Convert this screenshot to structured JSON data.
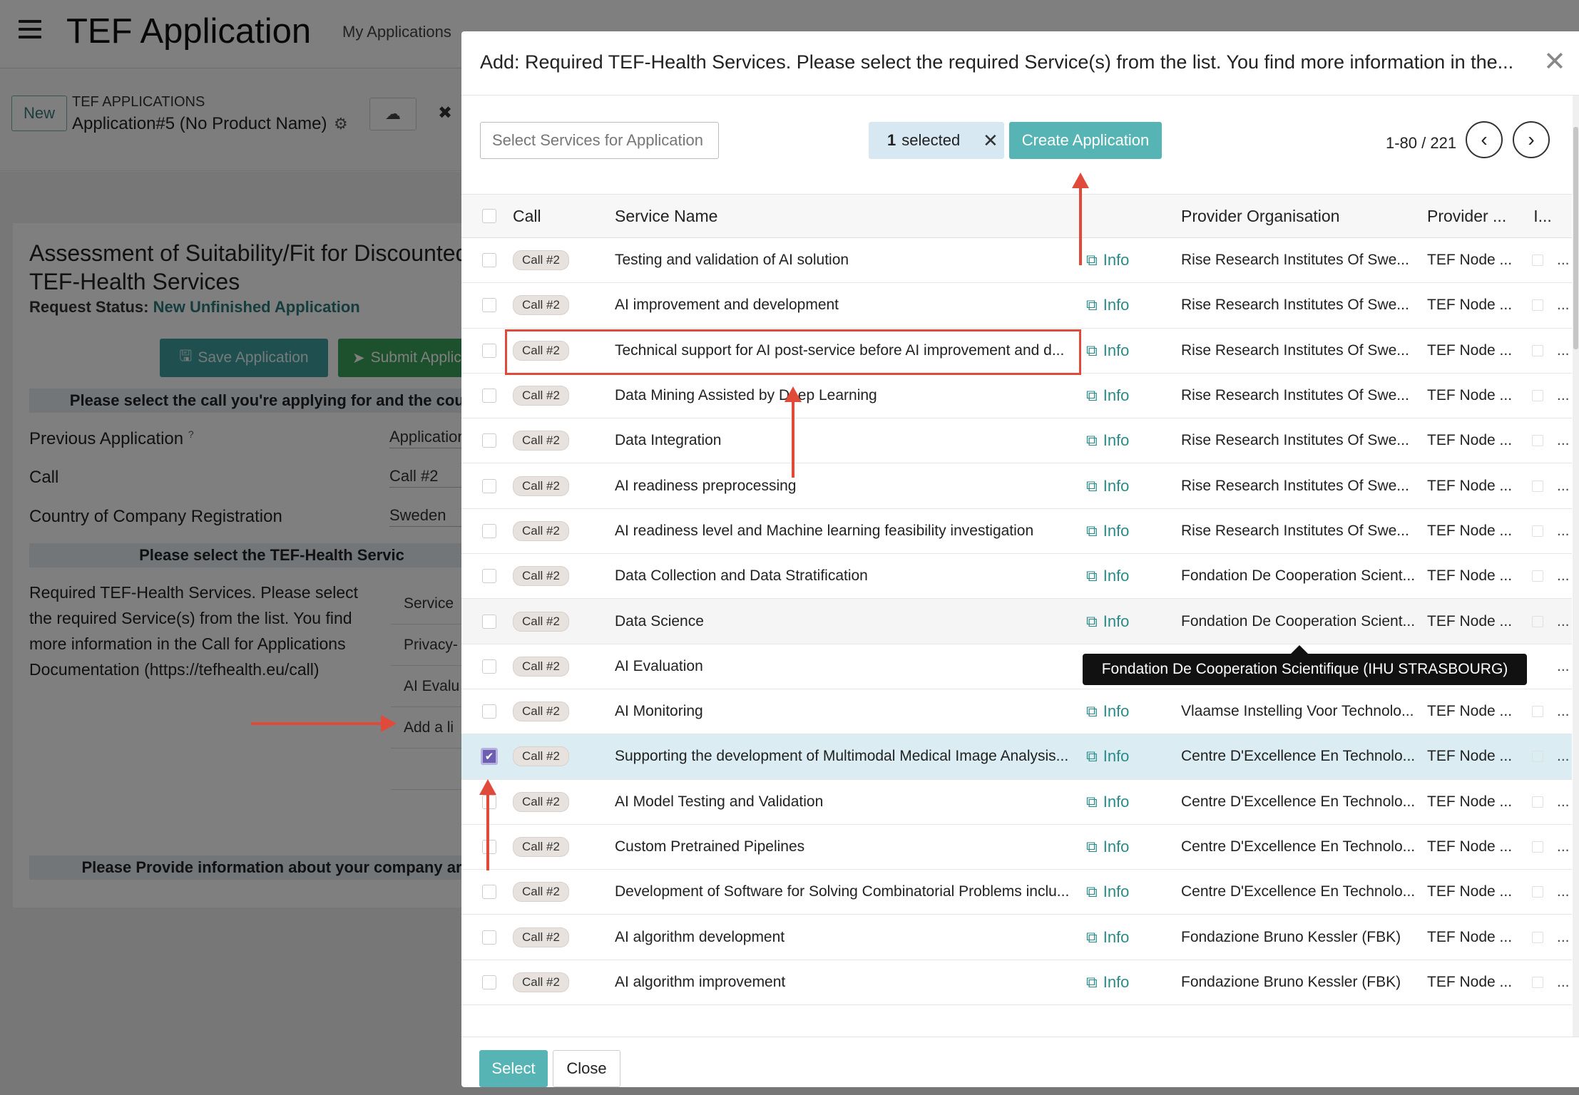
{
  "app": {
    "title": "TEF Application",
    "nav_link": "My Applications",
    "new_button": "New",
    "breadcrumb_small": "TEF APPLICATIONS",
    "breadcrumb_main": "Application#5 (No Product Name)",
    "close_glyph": "✖"
  },
  "form": {
    "title": "Assessment of Suitability/Fit for Discounted TEF-Health Services",
    "status_label": "Request Status:",
    "status_value": "New Unfinished Application",
    "save_button": "Save Application",
    "submit_button": "Submit Applic",
    "section1": "Please select the call you're applying for and the coun",
    "previous_application_label": "Previous Application",
    "previous_application_help": "?",
    "previous_application_value": "Application",
    "call_label": "Call",
    "call_value": "Call #2",
    "country_label": "Country of Company Registration",
    "country_value": "Sweden",
    "section2": "Please select the TEF-Health Servic",
    "description": "Required TEF-Health Services. Please select the required Service(s) from the list. You find more information in the Call for Applications Documentation (https://tefhealth.eu/call)",
    "services_header": "Service",
    "services_items": [
      "Privacy-",
      "AI Evalu",
      "Add a li"
    ],
    "section3": "Please Provide information about your company ar"
  },
  "modal": {
    "title": "Add: Required TEF-Health Services. Please select the required Service(s) from the list. You find more information in the...",
    "search_placeholder": "Select Services for Application",
    "selected_count": "1",
    "selected_text": "selected",
    "create_button": "Create Application",
    "pager": "1-80 / 221",
    "columns": {
      "call": "Call",
      "service_name": "Service Name",
      "provider_org": "Provider Organisation",
      "provider_node": "Provider ...",
      "extra": "I..."
    },
    "info_label": "Info",
    "more_glyph": "...",
    "rows": [
      {
        "call": "Call #2",
        "name": "Testing and validation of AI solution",
        "provider": "Rise Research Institutes Of Swe...",
        "node": "TEF Node ..."
      },
      {
        "call": "Call #2",
        "name": "AI improvement and development",
        "provider": "Rise Research Institutes Of Swe...",
        "node": "TEF Node ..."
      },
      {
        "call": "Call #2",
        "name": "Technical support for AI post-service before AI improvement and d...",
        "provider": "Rise Research Institutes Of Swe...",
        "node": "TEF Node ..."
      },
      {
        "call": "Call #2",
        "name": "Data Mining Assisted by Deep Learning",
        "provider": "Rise Research Institutes Of Swe...",
        "node": "TEF Node ..."
      },
      {
        "call": "Call #2",
        "name": "Data Integration",
        "provider": "Rise Research Institutes Of Swe...",
        "node": "TEF Node ..."
      },
      {
        "call": "Call #2",
        "name": "AI readiness preprocessing",
        "provider": "Rise Research Institutes Of Swe...",
        "node": "TEF Node ..."
      },
      {
        "call": "Call #2",
        "name": "AI readiness level and Machine learning feasibility investigation",
        "provider": "Rise Research Institutes Of Swe...",
        "node": "TEF Node ..."
      },
      {
        "call": "Call #2",
        "name": "Data Collection and Data Stratification",
        "provider": "Fondation De Cooperation Scient...",
        "node": "TEF Node ..."
      },
      {
        "call": "Call #2",
        "name": "Data Science",
        "provider": "Fondation De Cooperation Scient...",
        "node": "TEF Node ..."
      },
      {
        "call": "Call #2",
        "name": "AI Evaluation",
        "provider": "",
        "node": ""
      },
      {
        "call": "Call #2",
        "name": "AI Monitoring",
        "provider": "Vlaamse Instelling Voor Technolo...",
        "node": "TEF Node ..."
      },
      {
        "call": "Call #2",
        "name": "Supporting the development of Multimodal Medical Image Analysis...",
        "provider": "Centre D'Excellence En Technolo...",
        "node": "TEF Node ..."
      },
      {
        "call": "Call #2",
        "name": "AI Model Testing and Validation",
        "provider": "Centre D'Excellence En Technolo...",
        "node": "TEF Node ..."
      },
      {
        "call": "Call #2",
        "name": "Custom Pretrained Pipelines",
        "provider": "Centre D'Excellence En Technolo...",
        "node": "TEF Node ..."
      },
      {
        "call": "Call #2",
        "name": "Development of Software for Solving Combinatorial Problems inclu...",
        "provider": "Centre D'Excellence En Technolo...",
        "node": "TEF Node ..."
      },
      {
        "call": "Call #2",
        "name": "AI algorithm development",
        "provider": "Fondazione Bruno Kessler (FBK)",
        "node": "TEF Node ..."
      },
      {
        "call": "Call #2",
        "name": "AI algorithm improvement",
        "provider": "Fondazione Bruno Kessler (FBK)",
        "node": "TEF Node ..."
      }
    ],
    "tooltip": "Fondation De Cooperation Scientifique (IHU STRASBOURG)",
    "select_button": "Select",
    "close_button": "Close"
  },
  "colors": {
    "accent": "#56b4b4",
    "annotation": "#e04a3a",
    "selected_row": "#dbedf3"
  }
}
